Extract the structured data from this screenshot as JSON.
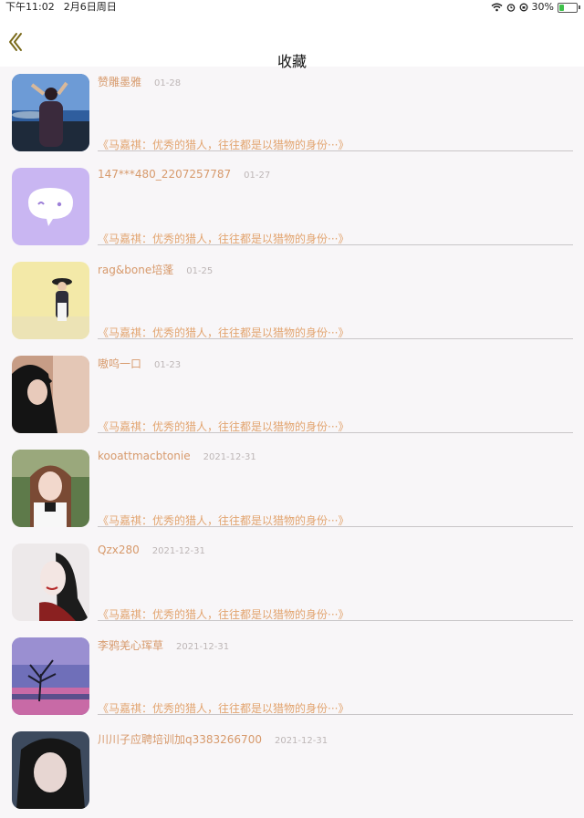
{
  "status_bar": {
    "time": "下午11:02",
    "date": "2月6日周日",
    "battery_percent": "30%",
    "battery_level": 0.3,
    "icons": [
      "wifi-icon",
      "alarm-icon",
      "orientation-lock-icon",
      "battery-icon"
    ]
  },
  "nav": {
    "title": "收藏",
    "back_icon": "chevron-left-icon",
    "accent_color": "#7a6a1a"
  },
  "colors": {
    "name": "#d79a6c",
    "quote": "#e2a46f",
    "date": "#bdb6b6",
    "background": "#f8f6f8"
  },
  "favorites": [
    {
      "name": "赞雕墨雅",
      "date": "01-28",
      "quote": "《马嘉祺：优秀的猎人，往往都是以猎物的身份···》",
      "avatar": "photo-lake-person"
    },
    {
      "name": "147***480_2207257787",
      "date": "01-27",
      "quote": "《马嘉祺：优秀的猎人，往往都是以猎物的身份···》",
      "avatar": "default-chat-avatar"
    },
    {
      "name": "rag&bone培蓬",
      "date": "01-25",
      "quote": "《马嘉祺：优秀的猎人，往往都是以猎物的身份···》",
      "avatar": "photo-girl-hat"
    },
    {
      "name": "嗷呜一口",
      "date": "01-23",
      "quote": "《马嘉祺：优秀的猎人，往往都是以猎物的身份···》",
      "avatar": "photo-dark-portrait"
    },
    {
      "name": "kooattmacbtonie",
      "date": "2021-12-31",
      "quote": "《马嘉祺：优秀的猎人，往往都是以猎物的身份···》",
      "avatar": "photo-girl-portrait"
    },
    {
      "name": "Qzx280",
      "date": "2021-12-31",
      "quote": "《马嘉祺：优秀的猎人，往往都是以猎物的身份···》",
      "avatar": "photo-illustration-girl"
    },
    {
      "name": "李鸦羌心珲草",
      "date": "2021-12-31",
      "quote": "《马嘉祺：优秀的猎人，往往都是以猎物的身份···》",
      "avatar": "photo-tree-sunset"
    },
    {
      "name": "川川子应聘培训加q3383266700",
      "date": "2021-12-31",
      "quote": "",
      "avatar": "photo-girl-closeup"
    }
  ]
}
